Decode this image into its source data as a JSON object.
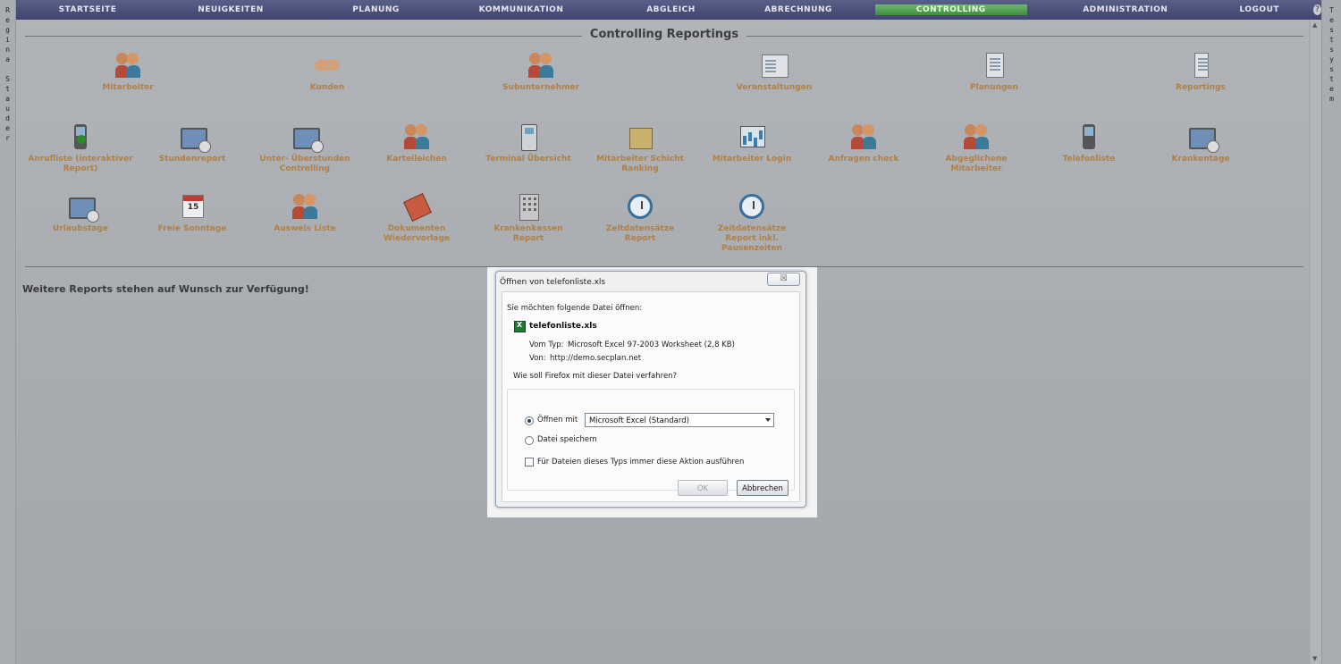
{
  "left_strip": [
    "R",
    "e",
    "g",
    "i",
    "n",
    "a",
    "",
    "S",
    "t",
    "a",
    "u",
    "d",
    "e",
    "r"
  ],
  "right_strip": [
    "T",
    "e",
    "s",
    "t",
    "s",
    "y",
    "s",
    "t",
    "e",
    "m"
  ],
  "nav": {
    "items": [
      "STARTSEITE",
      "NEUIGKEITEN",
      "PLANUNG",
      "KOMMUNIKATION",
      "ABGLEICH",
      "ABRECHNUNG",
      "CONTROLLING",
      "ADMINISTRATION",
      "LOGOUT"
    ],
    "active": "CONTROLLING"
  },
  "page_title": "Controlling Reportings",
  "tiles_row1": [
    "Mitarbeiter",
    "Kunden",
    "Subunternehmer",
    "Veranstaltungen",
    "Planungen",
    "Reportings"
  ],
  "tiles_row2": [
    "Anrufliste (interaktiver Report)",
    "Stundenreport",
    "Unter- Überstunden Controlling",
    "Karteileichen",
    "Terminal Übersicht",
    "Mitarbeiter Schicht Ranking",
    "Mitarbeiter Login",
    "Anfragen check",
    "Abgeglichene Mitarbeiter",
    "Telefonliste",
    "Krankentage"
  ],
  "tiles_row3": [
    "Urlaubstage",
    "Freie Sonntage",
    "Ausweis Liste",
    "Dokumenten Wiedervorlage",
    "Krankenkassen Report",
    "Zeitdatensätze Report",
    "Zeitdatensätze Report inkl. Pausenzeiten"
  ],
  "more_reports": "Weitere Reports stehen auf Wunsch zur Verfügung!",
  "dialog": {
    "title": "Öffnen von telefonliste.xls",
    "close": "☒",
    "intro": "Sie möchten folgende Datei öffnen:",
    "file_name": "telefonliste.xls",
    "type_label": "Vom Typ:",
    "type_value": "Microsoft Excel 97-2003 Worksheet (2,8 KB)",
    "from_label": "Von:",
    "from_value": "http://demo.secplan.net",
    "question": "Wie soll Firefox mit dieser Datei verfahren?",
    "open_with": "Öffnen mit",
    "app": "Microsoft Excel (Standard)",
    "save_file": "Datei speichern",
    "always": "Für Dateien dieses Typs immer diese Aktion ausführen",
    "ok": "OK",
    "cancel": "Abbrechen"
  }
}
